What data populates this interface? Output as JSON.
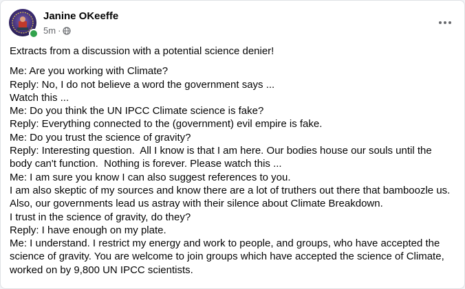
{
  "post": {
    "author": "Janine OKeeffe",
    "time": "5m",
    "separator": "·",
    "audience_icon": "globe-icon",
    "more_icon": "more-options-icon",
    "intro": "Extracts from a discussion with a potential science denier!",
    "lines": [
      "Me: Are you working with Climate?",
      "Reply: No, I do not believe a word the government says ...",
      "Watch this ...",
      "Me: Do you think the UN IPCC Climate science is fake?",
      "Reply: Everything connected to the (government) evil empire is fake.",
      "Me: Do you trust the science of gravity?",
      "Reply: Interesting question.  All I know is that I am here. Our bodies house our souls until the body can't function.  Nothing is forever. Please watch this ...",
      "Me: I am sure you know I can also suggest references to you.",
      "I am also skeptic of my sources and know there are a lot of truthers out there that bamboozle us.",
      "Also, our governments lead us astray with their silence about Climate Breakdown.",
      "I trust in the science of gravity, do they?",
      "Reply: I have enough on my plate.",
      "Me: I understand. I restrict my energy and work to people, and groups, who have accepted the science of gravity. You are welcome to join groups which have accepted the science of Climate, worked on by 9,800 UN IPCC scientists."
    ]
  },
  "colors": {
    "online_status": "#31a24c",
    "secondary_text": "#65676b",
    "primary_text": "#050505"
  }
}
